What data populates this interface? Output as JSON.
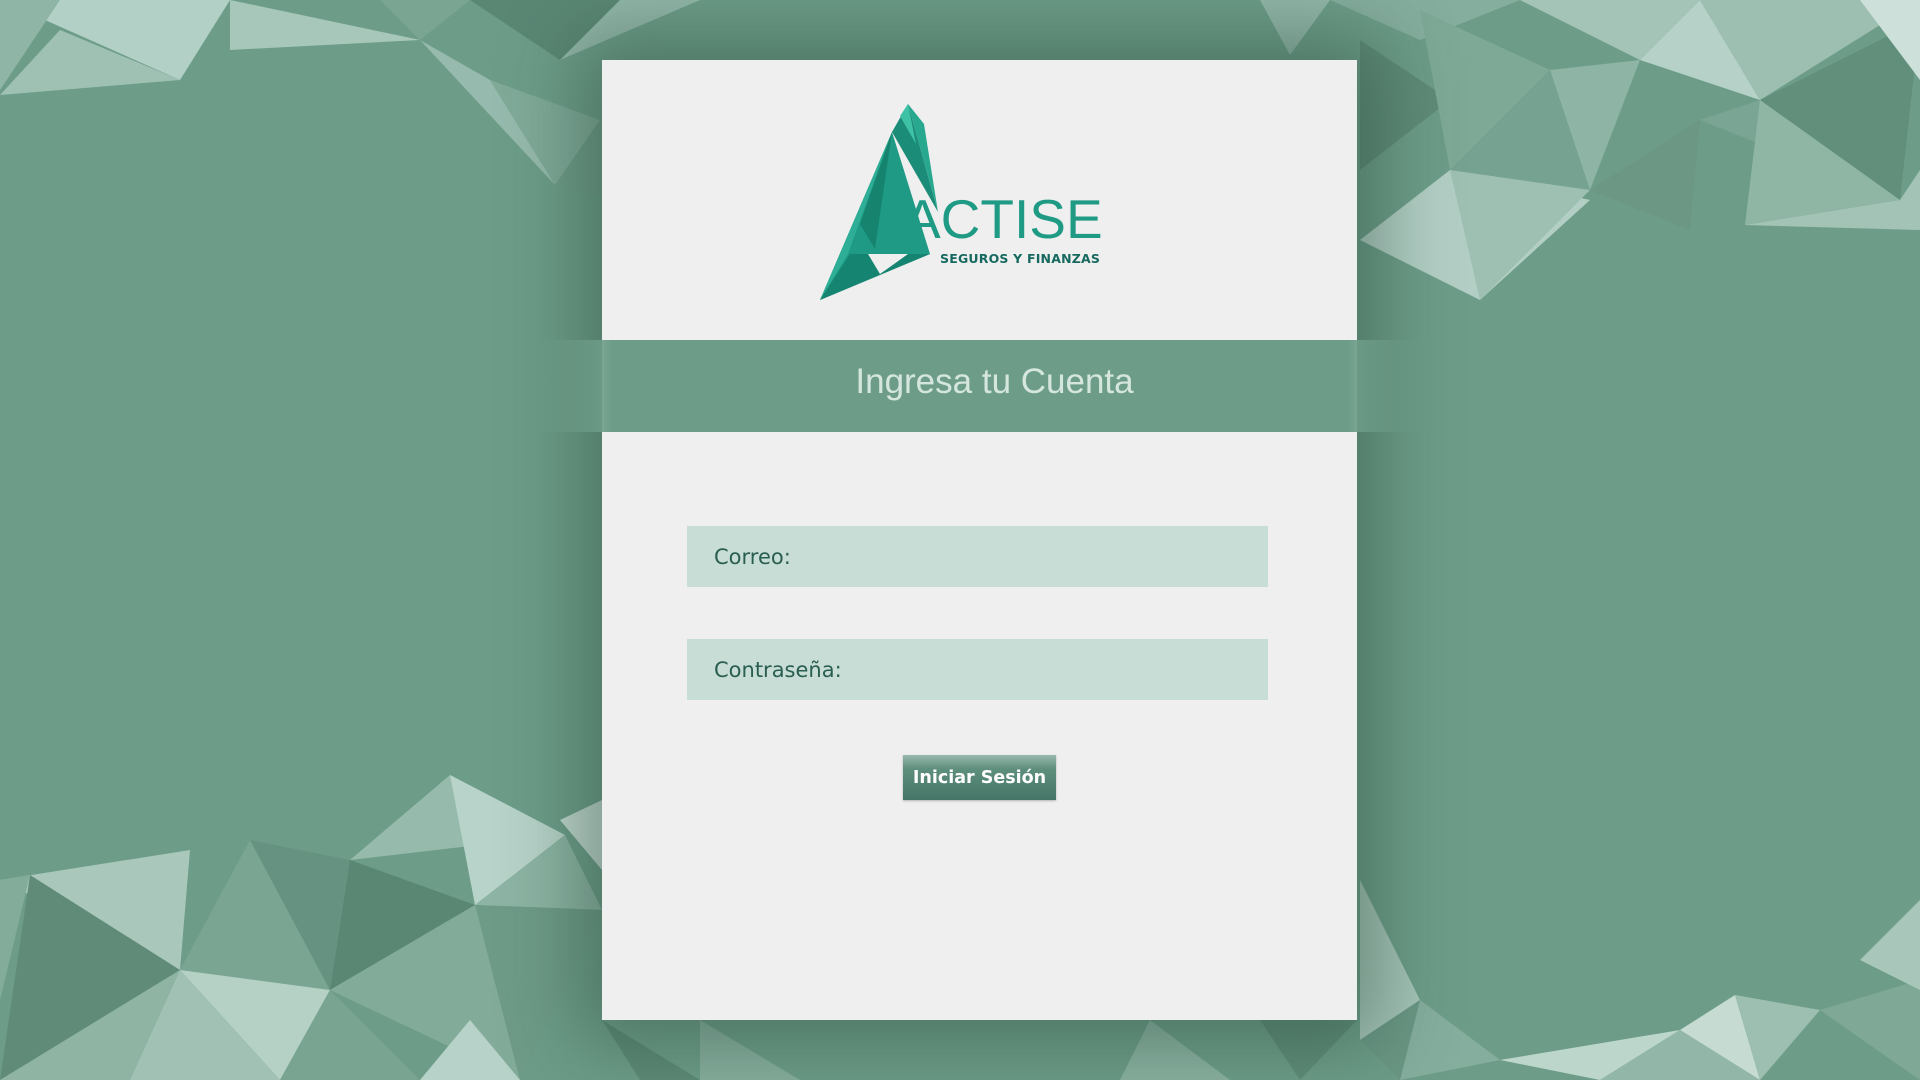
{
  "brand": {
    "name": "ACTISE",
    "tagline": "SEGUROS Y FINANZAS",
    "primary_color": "#1f9a84"
  },
  "banner": {
    "title": "Ingresa tu Cuenta"
  },
  "form": {
    "email_label": "Correo:",
    "email_value": "",
    "password_label": "Contraseña:",
    "password_value": "",
    "submit_label": "Iniciar Sesión"
  },
  "theme": {
    "background": "#6d9d89",
    "card": "#efefef",
    "field": "#c7ddd6",
    "label_text": "#2a5e50"
  }
}
